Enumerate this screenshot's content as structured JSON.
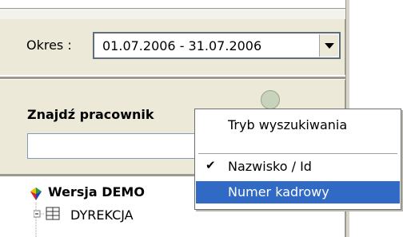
{
  "period": {
    "label": "Okres :",
    "value": "01.07.2006 - 31.07.2006"
  },
  "search": {
    "title": "Znajdź pracownik",
    "input_value": ""
  },
  "tree": {
    "root_label": "Wersja DEMO",
    "items": [
      {
        "label": "DYREKCJA"
      }
    ]
  },
  "context_menu": {
    "items": [
      {
        "label": "Tryb wyszukiwania",
        "checked": false,
        "selected": false
      },
      {
        "label": "Nazwisko / Id",
        "checked": true,
        "selected": false
      },
      {
        "label": "Numer kadrowy",
        "checked": false,
        "selected": true
      }
    ]
  },
  "colors": {
    "menu_selection": "#316ac5",
    "panel_background": "#ece9d8"
  }
}
